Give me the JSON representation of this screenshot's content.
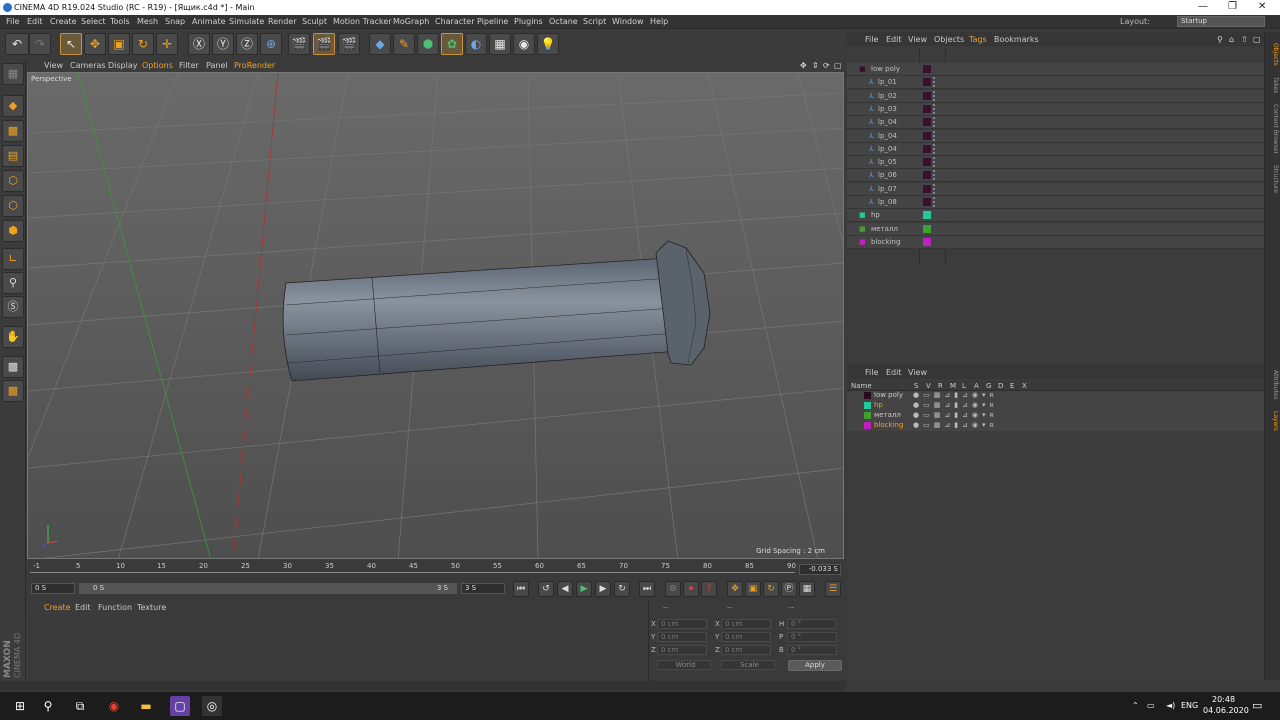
{
  "titlebar": {
    "title": "CINEMA 4D R19.024 Studio (RC - R19) - [Ящик.c4d *] - Main"
  },
  "menubar": {
    "items": [
      "File",
      "Edit",
      "Create",
      "Select",
      "Tools",
      "Mesh",
      "Snap",
      "Animate",
      "Simulate",
      "Render",
      "Sculpt",
      "Motion Tracker",
      "MoGraph",
      "Character",
      "Pipeline",
      "Plugins",
      "Octane",
      "Script",
      "Window",
      "Help"
    ],
    "layout_label": "Layout:",
    "layout_value": "Startup"
  },
  "viewport": {
    "menu": [
      "View",
      "Cameras",
      "Display",
      "Options",
      "Filter",
      "Panel",
      "ProRender"
    ],
    "label": "Perspective",
    "grid_spacing": "Grid Spacing : 2 cm"
  },
  "timeline": {
    "ticks": [
      "-1",
      "5",
      "10",
      "15",
      "20",
      "25",
      "30",
      "35",
      "40",
      "45",
      "50",
      "55",
      "60",
      "65",
      "70",
      "75",
      "80",
      "85",
      "90"
    ],
    "current": "-0.033 S"
  },
  "transport": {
    "start": "0 S",
    "range_start": "0 S",
    "range_end": "3 S",
    "end": "3 S"
  },
  "material": {
    "menu": [
      "Create",
      "Edit",
      "Function",
      "Texture"
    ]
  },
  "coords": {
    "headers": [
      "--",
      "--",
      "--"
    ],
    "rows": [
      {
        "a": "X",
        "av": "0 cm",
        "b": "X",
        "bv": "0 cm",
        "c": "H",
        "cv": "0 °"
      },
      {
        "a": "Y",
        "av": "0 cm",
        "b": "Y",
        "bv": "0 cm",
        "c": "P",
        "cv": "0 °"
      },
      {
        "a": "Z",
        "av": "0 cm",
        "b": "Z",
        "bv": "0 cm",
        "c": "B",
        "cv": "0 °"
      }
    ],
    "world": "World",
    "scale": "Scale",
    "apply": "Apply"
  },
  "objects": {
    "menu": [
      "File",
      "Edit",
      "View",
      "Objects",
      "Tags",
      "Bookmarks"
    ],
    "items": [
      {
        "name": "low poly",
        "color": "#3a1030",
        "level": 0
      },
      {
        "name": "lp_01",
        "color": "#3a1030",
        "level": 1
      },
      {
        "name": "lp_02",
        "color": "#3a1030",
        "level": 1
      },
      {
        "name": "lp_03",
        "color": "#3a1030",
        "level": 1
      },
      {
        "name": "lp_04",
        "color": "#3a1030",
        "level": 1
      },
      {
        "name": "lp_04",
        "color": "#3a1030",
        "level": 1
      },
      {
        "name": "lp_04",
        "color": "#3a1030",
        "level": 1
      },
      {
        "name": "lp_05",
        "color": "#3a1030",
        "level": 1
      },
      {
        "name": "lp_06",
        "color": "#3a1030",
        "level": 1
      },
      {
        "name": "lp_07",
        "color": "#3a1030",
        "level": 1
      },
      {
        "name": "lp_08",
        "color": "#3a1030",
        "level": 1
      },
      {
        "name": "hp",
        "color": "#22c8a0",
        "level": 0
      },
      {
        "name": "металл",
        "color": "#40a030",
        "level": 0
      },
      {
        "name": "blocking",
        "color": "#c020c0",
        "level": 0
      }
    ]
  },
  "layers": {
    "menu": [
      "File",
      "Edit",
      "View"
    ],
    "headers": [
      "Name",
      "S",
      "V",
      "R",
      "M",
      "L",
      "A",
      "G",
      "D",
      "E",
      "X"
    ],
    "items": [
      {
        "name": "low poly",
        "color": "#2a0a20",
        "text_color": "#c8c8c8"
      },
      {
        "name": "hp",
        "color": "#22c8a0",
        "text_color": "#f0a020"
      },
      {
        "name": "металл",
        "color": "#40a030",
        "text_color": "#c8c8c8"
      },
      {
        "name": "blocking",
        "color": "#c020c0",
        "text_color": "#f0a020"
      }
    ]
  },
  "right_tabs": [
    "Objects",
    "Takes",
    "Content Browser",
    "Structure",
    "Attributes",
    "Layers"
  ],
  "taskbar": {
    "lang": "ENG",
    "time": "20:48",
    "date": "04.06.2020"
  }
}
